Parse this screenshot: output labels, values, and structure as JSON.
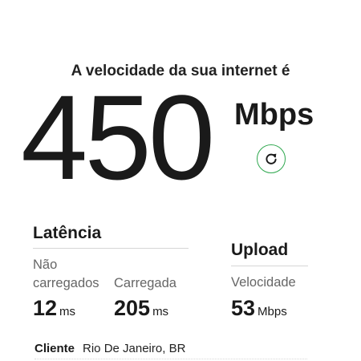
{
  "header": {
    "title": "A velocidade da sua internet é"
  },
  "speed": {
    "value": "450",
    "unit": "Mbps"
  },
  "refresh": {
    "icon": "refresh-icon",
    "accent_color": "#2fa84f"
  },
  "latency": {
    "title": "Latência",
    "unloaded": {
      "label": "Não carregados",
      "value": "12",
      "unit": "ms"
    },
    "loaded": {
      "label": "Carregada",
      "value": "205",
      "unit": "ms"
    }
  },
  "upload": {
    "title": "Upload",
    "speed": {
      "label": "Velocidade",
      "value": "53",
      "unit": "Mbps"
    }
  },
  "client": {
    "label": "Cliente",
    "value": "Rio De Janeiro, BR"
  }
}
